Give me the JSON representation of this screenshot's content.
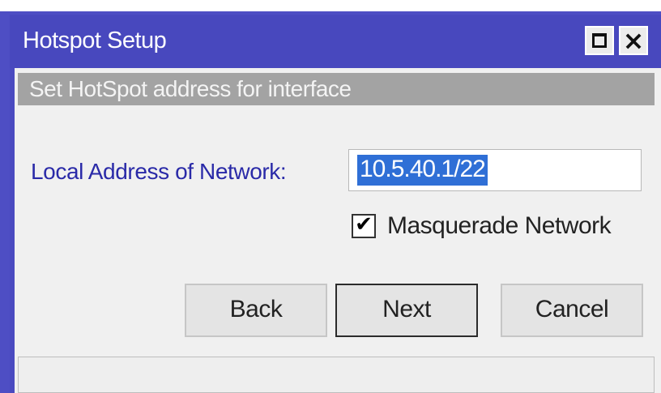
{
  "window": {
    "title": "Hotspot Setup",
    "maximize_icon": "maximize-icon",
    "close_icon": "close-icon",
    "close_glyph": "×"
  },
  "section": {
    "header": "Set HotSpot address for interface"
  },
  "form": {
    "local_address_label": "Local Address of Network:",
    "local_address_value": "10.5.40.1/22",
    "masquerade_label": "Masquerade Network",
    "masquerade_checked": true,
    "check_glyph": "✔"
  },
  "buttons": {
    "back": "Back",
    "next": "Next",
    "cancel": "Cancel"
  },
  "status": {
    "text": ""
  },
  "colors": {
    "titlebar": "#4848be",
    "label_blue": "#2a2aa8",
    "selection": "#2f6fd6",
    "section_header": "#a3a3a3"
  }
}
